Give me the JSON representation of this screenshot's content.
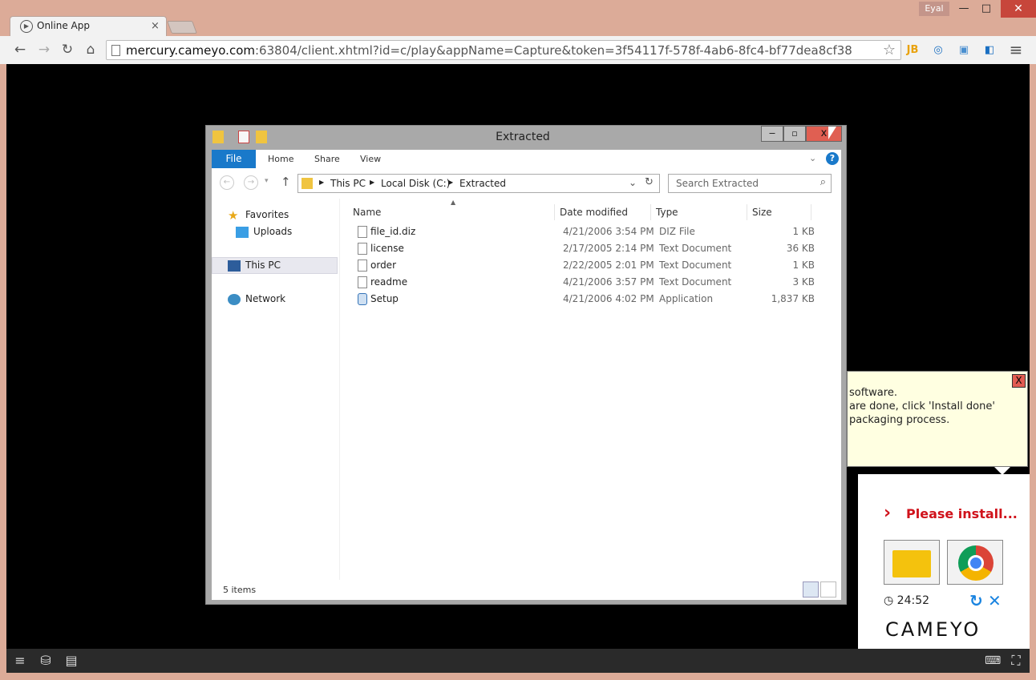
{
  "browser": {
    "tab_title": "Online App",
    "tab_close": "×",
    "user": "Eyal",
    "window_controls": {
      "minimize": "—",
      "maximize": "□",
      "close": "✕"
    },
    "url_host": "mercury.cameyo.com",
    "url_rest": ":63804/client.xhtml?id=c/play&appName=Capture&token=3f54117f-578f-4ab6-8fc4-bf77dea8cf38",
    "nav": {
      "back": "←",
      "forward": "→",
      "reload": "↻",
      "home": "⌂",
      "menu": "≡",
      "star": "☆"
    },
    "extensions": [
      "JB",
      "◎",
      "▣",
      "◧"
    ]
  },
  "explorer": {
    "title": "Extracted",
    "controls": {
      "minimize": "‒",
      "maximize": "▫",
      "close": "x"
    },
    "ribbon_tabs": {
      "file": "File",
      "home": "Home",
      "share": "Share",
      "view": "View"
    },
    "breadcrumb": [
      "This PC",
      "Local Disk (C:)",
      "Extracted"
    ],
    "search_placeholder": "Search Extracted",
    "nav_pane": {
      "favorites": "Favorites",
      "uploads": "Uploads",
      "this_pc": "This PC",
      "network": "Network"
    },
    "columns": {
      "name": "Name",
      "date": "Date modified",
      "type": "Type",
      "size": "Size"
    },
    "files": [
      {
        "name": "file_id.diz",
        "date": "4/21/2006 3:54 PM",
        "type": "DIZ File",
        "size": "1 KB"
      },
      {
        "name": "license",
        "date": "2/17/2005 2:14 PM",
        "type": "Text Document",
        "size": "36 KB"
      },
      {
        "name": "order",
        "date": "2/22/2005 2:01 PM",
        "type": "Text Document",
        "size": "1 KB"
      },
      {
        "name": "readme",
        "date": "4/21/2006 3:57 PM",
        "type": "Text Document",
        "size": "3 KB"
      },
      {
        "name": "Setup",
        "date": "4/21/2006 4:02 PM",
        "type": "Application",
        "size": "1,837 KB"
      }
    ],
    "status": "5 items"
  },
  "cameyo": {
    "tooltip_text": "software.\nare done, click 'Install done'\npackaging process.",
    "tooltip_close": "X",
    "chevron": "›",
    "please_install": "Please install...",
    "timer": "24:52",
    "clock": "◷",
    "refresh": "↻",
    "cancel": "✕",
    "logo": "CAMEYO"
  },
  "colors": {
    "accent": "#1979ca",
    "alert": "#d0121b",
    "close": "#e05f52"
  }
}
